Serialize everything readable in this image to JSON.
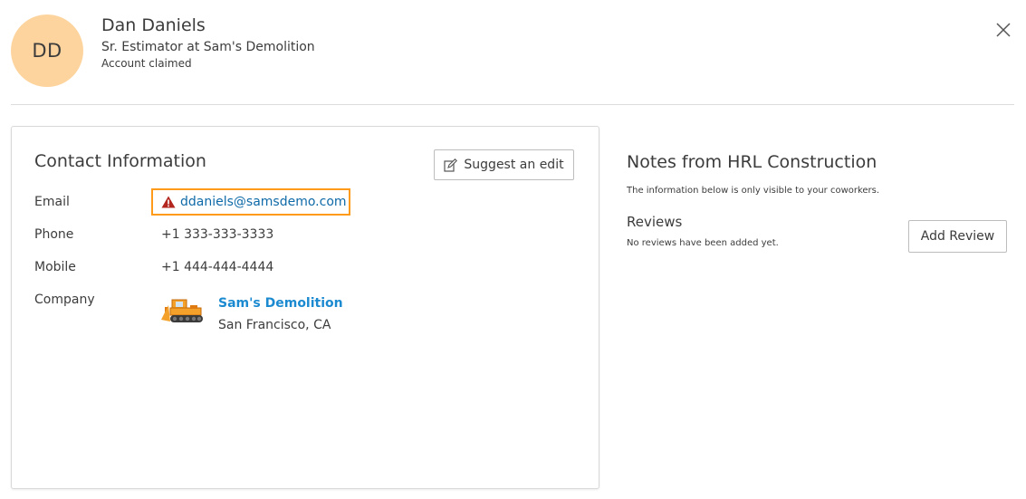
{
  "profile": {
    "initials": "DD",
    "name": "Dan Daniels",
    "title": "Sr. Estimator at Sam's Demolition",
    "status": "Account claimed"
  },
  "contact": {
    "heading": "Contact Information",
    "suggest_label": "Suggest an edit",
    "email_label": "Email",
    "email": "ddaniels@samsdemo.com",
    "phone_label": "Phone",
    "phone": "+1 333-333-3333",
    "mobile_label": "Mobile",
    "mobile": "+1 444-444-4444",
    "company_label": "Company",
    "company_name": "Sam's Demolition",
    "company_location": "San Francisco, CA"
  },
  "notes": {
    "heading": "Notes from HRL Construction",
    "subtitle": "The information below is only visible to your coworkers.",
    "reviews_heading": "Reviews",
    "reviews_empty": "No reviews have been added yet.",
    "add_review_label": "Add Review"
  },
  "icons": {
    "close": "close-icon",
    "edit": "edit-icon",
    "warning": "warning-icon",
    "company_logo": "bulldozer-icon"
  },
  "colors": {
    "avatar_bg": "#fdd49e",
    "warning_border": "#ff9b1a",
    "warning_icon": "#b3261e",
    "link": "#1b8ad0"
  }
}
